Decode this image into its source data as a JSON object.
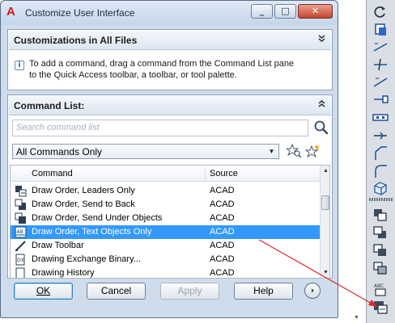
{
  "window": {
    "title": "Customize User Interface",
    "minimize": "_",
    "maximize": "□",
    "close": "✕"
  },
  "customizations_panel": {
    "header": "Customizations in All Files",
    "collapse_glyph": "⌄",
    "info_lines": [
      "To add a command, drag a command from the Command List pane",
      "to the Quick Access toolbar, a toolbar, or tool palette."
    ]
  },
  "command_list": {
    "header": "Command List:",
    "collapse_glyph": "⌃",
    "search_placeholder": "Search command list",
    "filter_value": "All Commands Only",
    "columns": {
      "command": "Command",
      "source": "Source"
    },
    "rows": [
      {
        "command": "Draw Order, Leaders Only",
        "source": "ACAD",
        "icon": "draw-order-leaders-icon",
        "selected": false
      },
      {
        "command": "Draw Order, Send to Back",
        "source": "ACAD",
        "icon": "send-to-back-icon",
        "selected": false
      },
      {
        "command": "Draw Order, Send Under Objects",
        "source": "ACAD",
        "icon": "send-under-icon",
        "selected": false
      },
      {
        "command": "Draw Order, Text Objects Only",
        "source": "ACAD",
        "icon": "text-objects-only-icon",
        "selected": true
      },
      {
        "command": "Draw Toolbar",
        "source": "ACAD",
        "icon": "draw-toolbar-icon",
        "selected": false
      },
      {
        "command": "Drawing Exchange Binary...",
        "source": "ACAD",
        "icon": "drawing-exchange-icon",
        "selected": false
      },
      {
        "command": "Drawing History",
        "source": "ACAD",
        "icon": "drawing-history-icon",
        "selected": false
      }
    ]
  },
  "buttons": {
    "ok": "OK",
    "cancel": "Cancel",
    "apply": "Apply",
    "help": "Help",
    "more": "›"
  },
  "colors": {
    "selection": "#3399ff",
    "drag_arrow": "#e0242a"
  },
  "palette": {
    "icons": [
      "rotate-icon",
      "copy-icon",
      "extend-line-icon",
      "trim-line-icon",
      "stretch-icon",
      "join-icon",
      "break-icon",
      "chamfer-icon",
      "fillet-icon",
      "3d-box-icon",
      "bring-to-front-icon",
      "send-to-back-icon",
      "bring-above-icon",
      "send-under-icon",
      "text-to-front-icon",
      "text-objects-only-icon"
    ]
  }
}
